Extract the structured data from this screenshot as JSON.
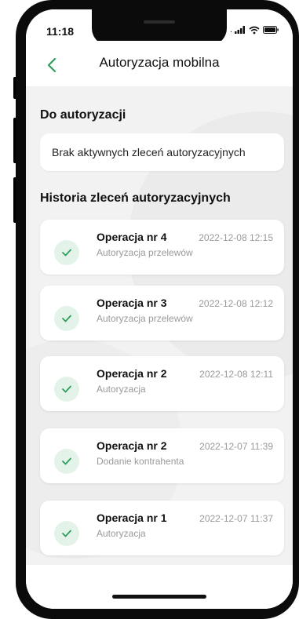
{
  "status_bar": {
    "time": "11:18",
    "icons": [
      "signal-icon",
      "wifi-icon",
      "battery-icon"
    ]
  },
  "header": {
    "back_icon": "chevron-left-icon",
    "title": "Autoryzacja mobilna"
  },
  "pending": {
    "section_title": "Do autoryzacji",
    "empty_message": "Brak aktywnych zleceń autoryzacyjnych"
  },
  "history": {
    "section_title": "Historia zleceń autoryzacyjnych",
    "items": [
      {
        "title": "Operacja nr 4",
        "subtitle": "Autoryzacja przelewów",
        "date": "2022-12-08 12:15",
        "icon": "check-icon"
      },
      {
        "title": "Operacja nr 3",
        "subtitle": "Autoryzacja przelewów",
        "date": "2022-12-08 12:12",
        "icon": "check-icon"
      },
      {
        "title": "Operacja nr 2",
        "subtitle": "Autoryzacja",
        "date": "2022-12-08 12:11",
        "icon": "check-icon"
      },
      {
        "title": "Operacja nr 2",
        "subtitle": "Dodanie kontrahenta",
        "date": "2022-12-07 11:39",
        "icon": "check-icon"
      },
      {
        "title": "Operacja nr 1",
        "subtitle": "Autoryzacja",
        "date": "2022-12-07 11:37",
        "icon": "check-icon"
      }
    ]
  },
  "colors": {
    "accent_green": "#2e9e5b",
    "check_bg": "#e4f3e9",
    "screen_bg": "#f2f2f2",
    "muted_text": "#9a9a9a"
  }
}
